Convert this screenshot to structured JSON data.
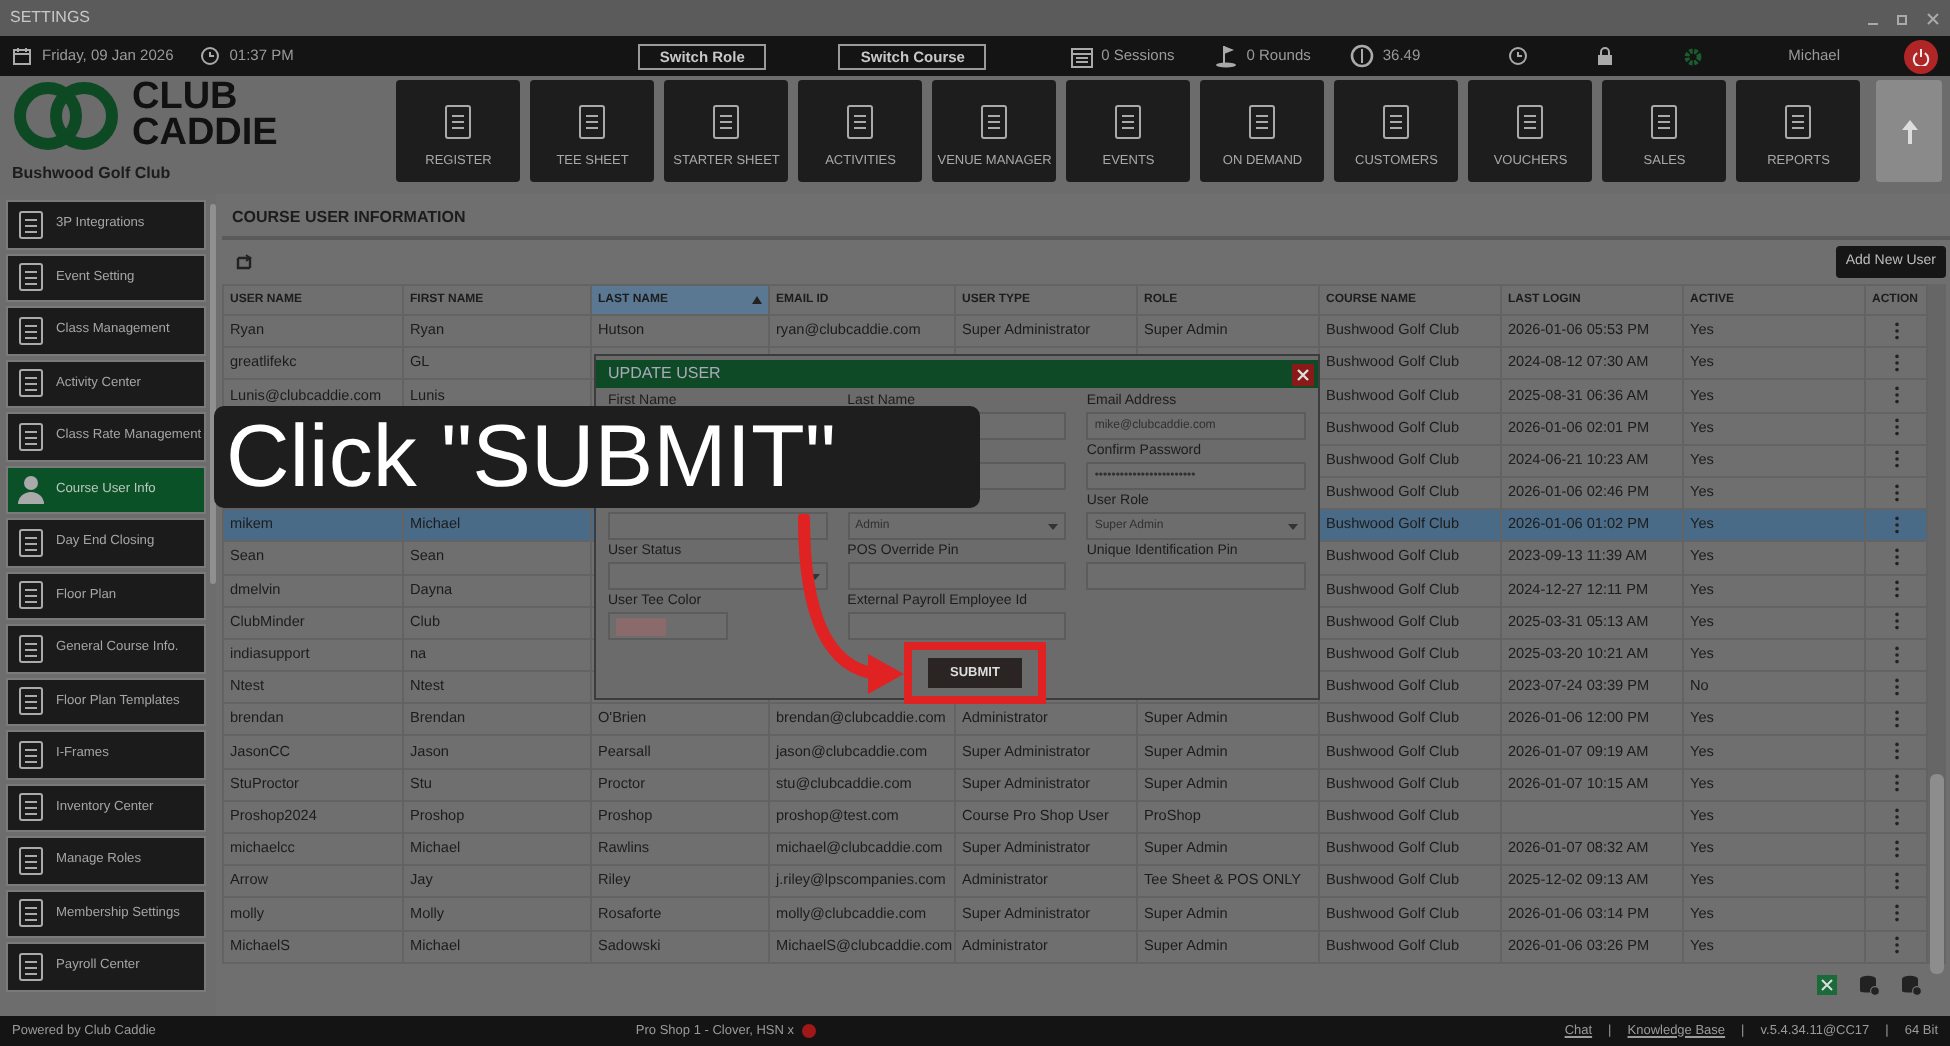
{
  "window": {
    "title": "SETTINGS"
  },
  "top_bar": {
    "date": "Friday, 09 Jan 2026",
    "time": "01:37 PM",
    "buttons": [
      "Switch Role",
      "Switch Course"
    ],
    "sessions": "0 Sessions",
    "rounds": "0 Rounds",
    "balance": "36.49",
    "user": "Michael"
  },
  "logo": {
    "line1": "CLUB",
    "line2": "CADDIE",
    "club": "Bushwood Golf Club"
  },
  "modules": [
    "REGISTER",
    "TEE SHEET",
    "STARTER SHEET",
    "ACTIVITIES",
    "VENUE MANAGER",
    "EVENTS",
    "ON DEMAND",
    "CUSTOMERS",
    "VOUCHERS",
    "SALES",
    "REPORTS"
  ],
  "sidebar": {
    "items": [
      {
        "label": "3P Integrations",
        "selected": false
      },
      {
        "label": "Event Setting",
        "selected": false
      },
      {
        "label": "Class Management",
        "selected": false
      },
      {
        "label": "Activity  Center",
        "selected": false
      },
      {
        "label": "Class Rate Management",
        "selected": false
      },
      {
        "label": "Course User Info",
        "selected": true
      },
      {
        "label": "Day End Closing",
        "selected": false
      },
      {
        "label": "Floor Plan",
        "selected": false
      },
      {
        "label": "General Course Info.",
        "selected": false
      },
      {
        "label": "Floor Plan Templates",
        "selected": false
      },
      {
        "label": "I-Frames",
        "selected": false
      },
      {
        "label": "Inventory Center",
        "selected": false
      },
      {
        "label": "Manage Roles",
        "selected": false
      },
      {
        "label": "Membership Settings",
        "selected": false
      },
      {
        "label": "Payroll Center",
        "selected": false
      }
    ]
  },
  "section_title": "COURSE USER INFORMATION",
  "add_button": "Add New User",
  "table": {
    "columns": [
      {
        "label": "USER NAME",
        "sorted": false
      },
      {
        "label": "FIRST NAME",
        "sorted": false
      },
      {
        "label": "LAST NAME",
        "sorted": true
      },
      {
        "label": "EMAIL ID",
        "sorted": false
      },
      {
        "label": "USER TYPE",
        "sorted": false
      },
      {
        "label": "ROLE",
        "sorted": false
      },
      {
        "label": "COURSE NAME",
        "sorted": false
      },
      {
        "label": "LAST LOGIN",
        "sorted": false
      },
      {
        "label": "ACTIVE",
        "sorted": false
      },
      {
        "label": "ACTION",
        "sorted": false
      }
    ],
    "rows": [
      {
        "selected": false,
        "cells": [
          "Ryan",
          "Ryan",
          "Hutson",
          "ryan@clubcaddie.com",
          "Super Administrator",
          "Super Admin",
          "Bushwood Golf Club",
          "2026-01-06 05:53 PM",
          "Yes"
        ]
      },
      {
        "selected": false,
        "cells": [
          "greatlifekc",
          "GL",
          null,
          null,
          null,
          null,
          "Bushwood Golf Club",
          "2024-08-12 07:30 AM",
          "Yes"
        ]
      },
      {
        "selected": false,
        "cells": [
          "Lunis@clubcaddie.com",
          "Lunis",
          null,
          null,
          null,
          null,
          "Bushwood Golf Club",
          "2025-08-31 06:36 AM",
          "Yes"
        ]
      },
      {
        "selected": false,
        "cells": [
          null,
          null,
          null,
          null,
          null,
          null,
          "Bushwood Golf Club",
          "2026-01-06 02:01 PM",
          "Yes"
        ]
      },
      {
        "selected": false,
        "cells": [
          null,
          null,
          null,
          null,
          null,
          null,
          "Bushwood Golf Club",
          "2024-06-21 10:23 AM",
          "Yes"
        ]
      },
      {
        "selected": false,
        "cells": [
          null,
          null,
          null,
          null,
          null,
          null,
          "Bushwood Golf Club",
          "2026-01-06 02:46 PM",
          "Yes"
        ]
      },
      {
        "selected": true,
        "cells": [
          "mikem",
          "Michael",
          null,
          null,
          null,
          null,
          "Bushwood Golf Club",
          "2026-01-06 01:02 PM",
          "Yes"
        ]
      },
      {
        "selected": false,
        "cells": [
          "Sean",
          "Sean",
          null,
          null,
          null,
          null,
          "Bushwood Golf Club",
          "2023-09-13 11:39 AM",
          "Yes"
        ]
      },
      {
        "selected": false,
        "cells": [
          "dmelvin",
          "Dayna",
          null,
          null,
          null,
          null,
          "Bushwood Golf Club",
          "2024-12-27 12:11 PM",
          "Yes"
        ]
      },
      {
        "selected": false,
        "cells": [
          "ClubMinder",
          "Club",
          null,
          null,
          null,
          null,
          "Bushwood Golf Club",
          "2025-03-31 05:13 AM",
          "Yes"
        ]
      },
      {
        "selected": false,
        "cells": [
          "indiasupport",
          "na",
          null,
          null,
          null,
          null,
          "Bushwood Golf Club",
          "2025-03-20 10:21 AM",
          "Yes"
        ]
      },
      {
        "selected": false,
        "cells": [
          "Ntest",
          "Ntest",
          null,
          null,
          null,
          null,
          "Bushwood Golf Club",
          "2023-07-24 03:39 PM",
          "No"
        ]
      },
      {
        "selected": false,
        "cells": [
          "brendan",
          "Brendan",
          "O'Brien",
          "brendan@clubcaddie.com",
          "Administrator",
          "Super Admin",
          "Bushwood Golf Club",
          "2026-01-06 12:00 PM",
          "Yes"
        ]
      },
      {
        "selected": false,
        "cells": [
          "JasonCC",
          "Jason",
          "Pearsall",
          "jason@clubcaddie.com",
          "Super Administrator",
          "Super Admin",
          "Bushwood Golf Club",
          "2026-01-07 09:19 AM",
          "Yes"
        ]
      },
      {
        "selected": false,
        "cells": [
          "StuProctor",
          "Stu",
          "Proctor",
          "stu@clubcaddie.com",
          "Super Administrator",
          "Super Admin",
          "Bushwood Golf Club",
          "2026-01-07 10:15 AM",
          "Yes"
        ]
      },
      {
        "selected": false,
        "cells": [
          "Proshop2024",
          "Proshop",
          "Proshop",
          "proshop@test.com",
          "Course Pro Shop User",
          "ProShop",
          "Bushwood Golf Club",
          null,
          "Yes"
        ]
      },
      {
        "selected": false,
        "cells": [
          "michaelcc",
          "Michael",
          "Rawlins",
          "michael@clubcaddie.com",
          "Super Administrator",
          "Super Admin",
          "Bushwood Golf Club",
          "2026-01-07 08:32 AM",
          "Yes"
        ]
      },
      {
        "selected": false,
        "cells": [
          "Arrow",
          "Jay",
          "Riley",
          "j.riley@lpscompanies.com",
          "Administrator",
          "Tee Sheet & POS ONLY",
          "Bushwood Golf Club",
          "2025-12-02 09:13 AM",
          "Yes"
        ]
      },
      {
        "selected": false,
        "cells": [
          "molly",
          "Molly",
          "Rosaforte",
          "molly@clubcaddie.com",
          "Super Administrator",
          "Super Admin",
          "Bushwood Golf Club",
          "2026-01-06 03:14 PM",
          "Yes"
        ]
      },
      {
        "selected": false,
        "cells": [
          "MichaelS",
          "Michael",
          "Sadowski",
          "MichaelS@clubcaddie.com",
          "Administrator",
          "Super Admin",
          "Bushwood Golf Club",
          "2026-01-06 03:26 PM",
          "Yes"
        ]
      }
    ]
  },
  "modal": {
    "title": "UPDATE USER",
    "fields": [
      {
        "kind": "text",
        "label": "First Name"
      },
      {
        "kind": "text",
        "label": "Last Name"
      },
      {
        "kind": "text",
        "label": "Email Address",
        "value": "mike@clubcaddie.com"
      },
      {
        "kind": "text"
      },
      {
        "kind": "text"
      },
      {
        "kind": "text",
        "label": "Confirm Password",
        "value": "••••••••••••••••••••••••"
      },
      {
        "kind": "text"
      },
      {
        "kind": "select",
        "value": "Admin"
      },
      {
        "kind": "select",
        "label": "User Role",
        "value": "Super Admin"
      },
      {
        "kind": "select",
        "label": "User Status"
      },
      {
        "kind": "text",
        "label": "POS Override Pin"
      },
      {
        "kind": "text",
        "label": "Unique Identification Pin"
      },
      {
        "kind": "color",
        "label": "User Tee Color",
        "color": "#8a6a6a"
      },
      {
        "kind": "text",
        "label": "External Payroll Employee Id"
      }
    ],
    "submit": "SUBMIT"
  },
  "callout": {
    "text": "Click \"SUBMIT\""
  },
  "status_bar": {
    "powered": "Powered by Club Caddie",
    "station": "Pro Shop 1 - Clover, HSN x",
    "right": [
      {
        "kind": "link",
        "text": "Chat"
      },
      {
        "kind": "text",
        "text": "|"
      },
      {
        "kind": "link",
        "text": "Knowledge Base"
      },
      {
        "kind": "text",
        "text": "|"
      },
      {
        "kind": "text",
        "text": "v.5.4.34.11@CC17"
      },
      {
        "kind": "text",
        "text": "|"
      },
      {
        "kind": "text",
        "text": "64 Bit"
      }
    ]
  }
}
